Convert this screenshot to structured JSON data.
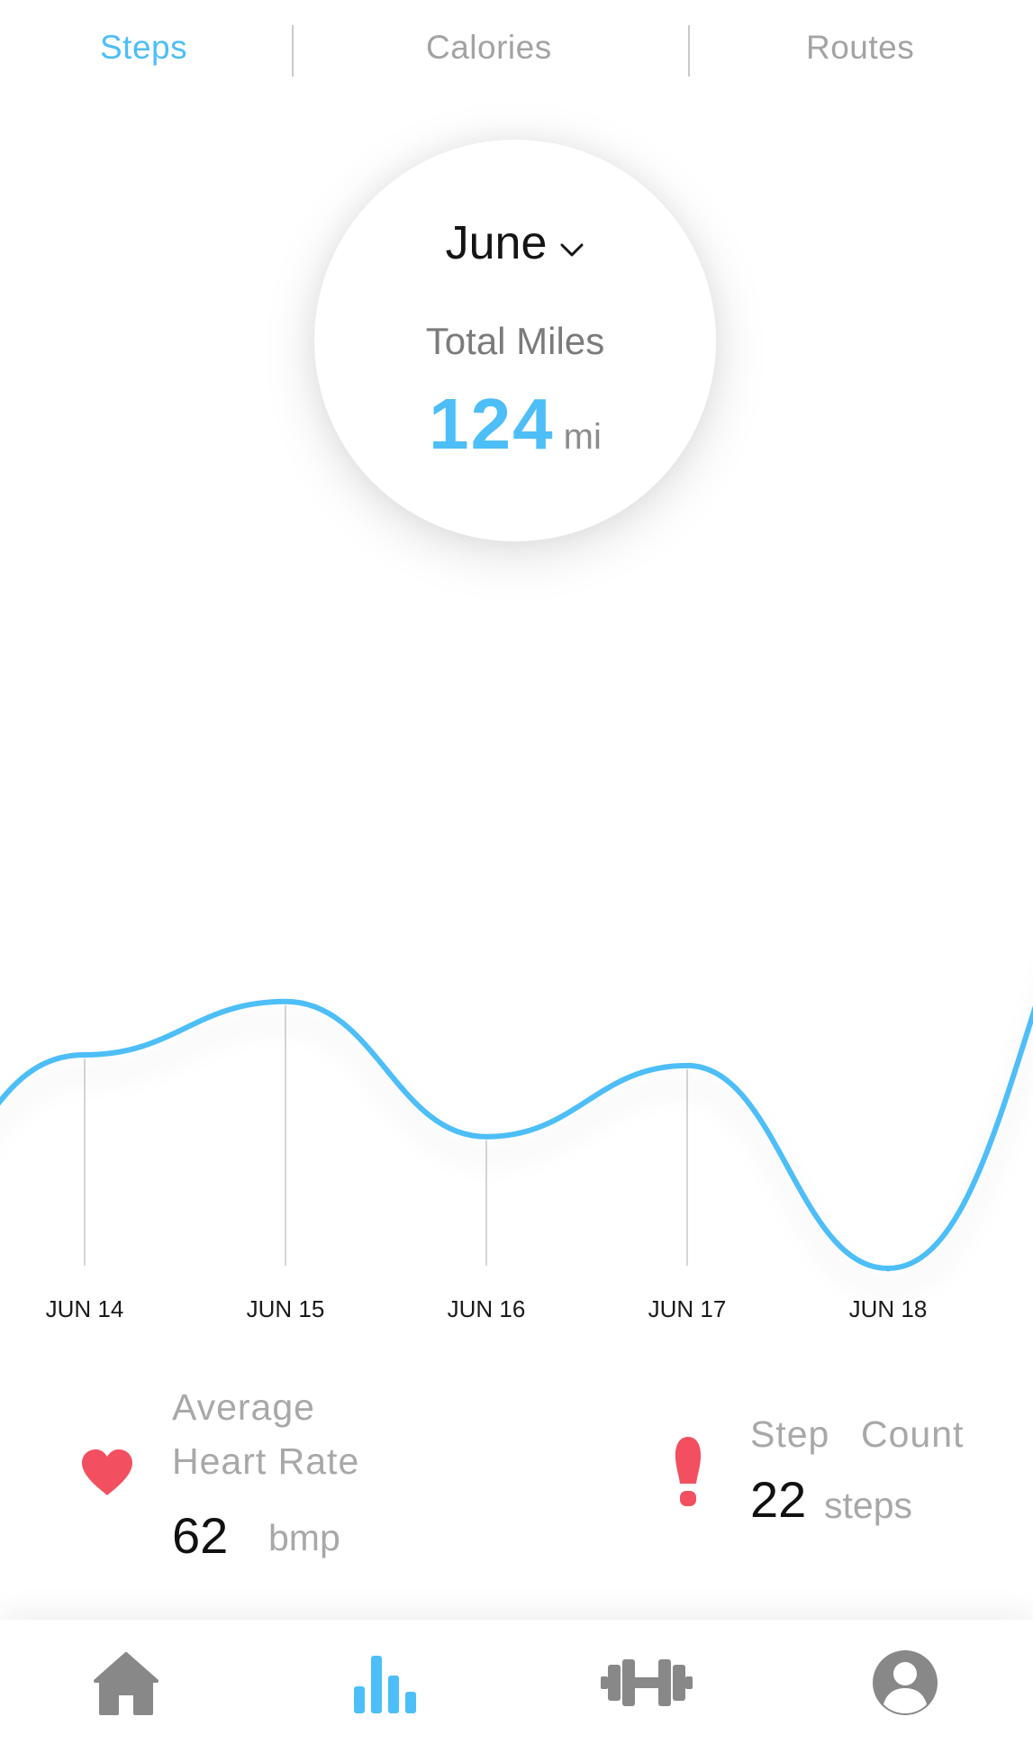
{
  "tabs": [
    {
      "label": "Steps",
      "active": true
    },
    {
      "label": "Calories",
      "active": false
    },
    {
      "label": "Routes",
      "active": false
    }
  ],
  "summary": {
    "month": "June",
    "label": "Total Miles",
    "value": "124",
    "unit": "mi"
  },
  "chart_data": {
    "type": "line",
    "smooth": true,
    "categories": [
      "JUN 14",
      "JUN 15",
      "JUN 16",
      "JUN 17",
      "JUN 18"
    ],
    "values": [
      0.6,
      0.75,
      0.37,
      0.57,
      0.0
    ],
    "ylim": [
      0,
      1
    ],
    "grid": false,
    "title": "",
    "xlabel": "",
    "ylabel": "",
    "line_color": "#4dbef7"
  },
  "stats": {
    "heart_rate": {
      "label_line1": "Average",
      "label_line2": "Heart Rate",
      "value": "62",
      "unit": "bmp",
      "icon": "heart-icon",
      "color": "#f25060"
    },
    "steps": {
      "label_word1": "Step",
      "label_word2": "Count",
      "value": "22",
      "unit": "steps",
      "icon": "footprint-icon",
      "color": "#f25060"
    }
  },
  "nav": [
    {
      "icon": "home-icon",
      "active": false
    },
    {
      "icon": "bar-chart-icon",
      "active": true
    },
    {
      "icon": "dumbbell-icon",
      "active": false
    },
    {
      "icon": "profile-icon",
      "active": false
    }
  ],
  "colors": {
    "accent": "#4dbef7",
    "inactive": "#888888",
    "alert": "#f25060"
  }
}
